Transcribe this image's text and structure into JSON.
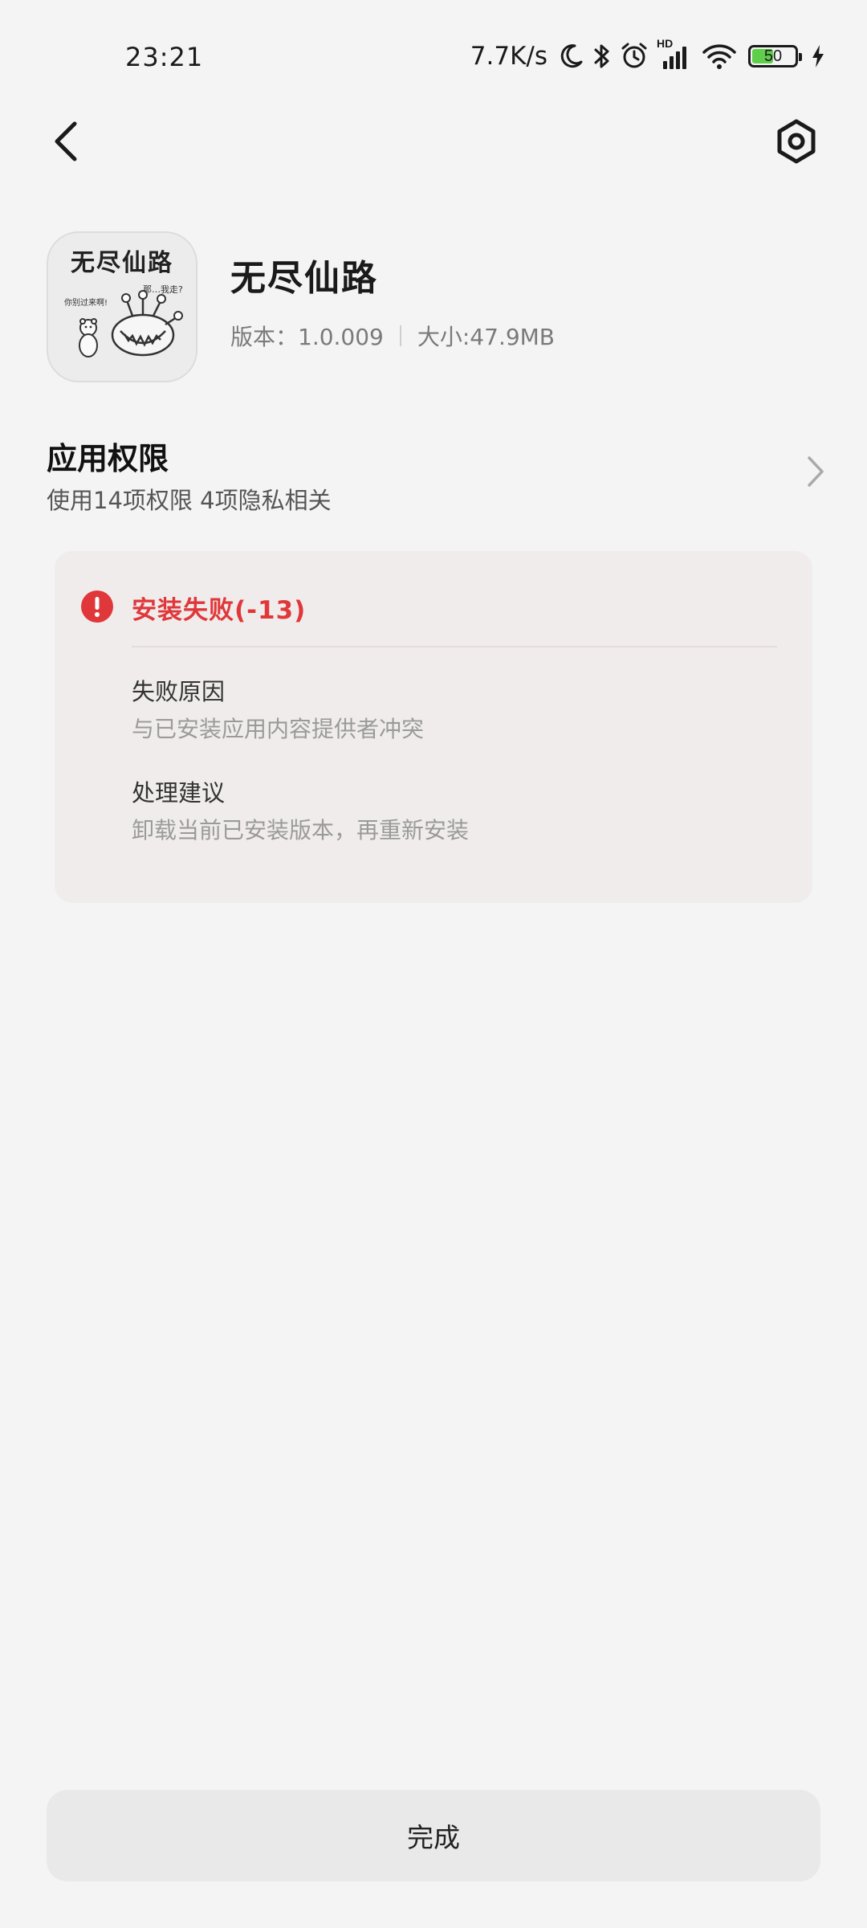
{
  "status_bar": {
    "time": "23:21",
    "net_speed": "7.7K/s",
    "battery_level": "50",
    "battery_fraction": 0.5,
    "battery_color": "#5fcf4b",
    "signal_label": "HD",
    "icons": [
      "moon-icon",
      "bluetooth-icon",
      "alarm-icon",
      "signal-icon",
      "wifi-icon",
      "battery-icon",
      "charging-icon"
    ]
  },
  "nav": {
    "back_icon": "chevron-left-icon",
    "settings_icon": "settings-hexagon-icon"
  },
  "app": {
    "icon_title": "无尽仙路",
    "icon_caption_left": "你别过来啊!",
    "icon_caption_right": "那…我走?",
    "name": "无尽仙路",
    "version": "版本：1.0.009",
    "size": "大小:47.9MB"
  },
  "permissions": {
    "title": "应用权限",
    "subtitle": "使用14项权限 4项隐私相关"
  },
  "error": {
    "color": "#e0383a",
    "title": "安装失败(-13)",
    "reason_label": "失败原因",
    "reason_text": "与已安装应用内容提供者冲突",
    "advice_label": "处理建议",
    "advice_text": "卸载当前已安装版本，再重新安装"
  },
  "footer": {
    "done_label": "完成"
  }
}
